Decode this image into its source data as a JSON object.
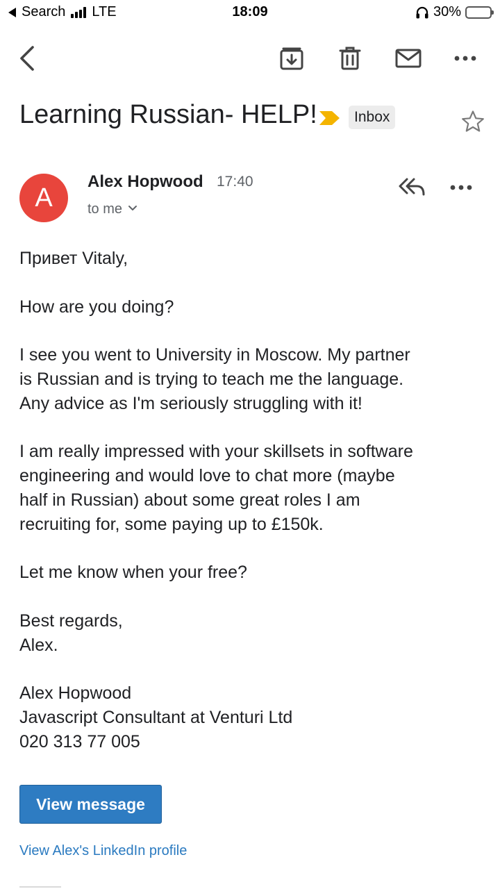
{
  "status_bar": {
    "back_app": "Search",
    "carrier": "LTE",
    "time": "18:09",
    "battery": "30%",
    "battery_level": 0.3
  },
  "toolbar": {
    "icons": [
      "back-arrow-icon",
      "archive-icon",
      "trash-icon",
      "mark-unread-icon",
      "more-icon"
    ]
  },
  "email": {
    "subject": "Learning Russian- HELP!",
    "label": "Inbox",
    "importance_color": "#f4b400",
    "sender": {
      "initial": "A",
      "avatar_color": "#e8453c",
      "name": "Alex Hopwood",
      "time": "17:40",
      "recipient": "to me"
    },
    "body": {
      "greeting": "Привет Vitaly,",
      "p1": "How are you doing?",
      "p2": [
        "I see you went to University in Moscow. My partner",
        "is Russian and is trying to teach me the language.",
        "Any advice as I'm seriously struggling with it!"
      ],
      "p3": [
        "I am really impressed with your skillsets in software",
        "engineering and would love to chat more (maybe",
        "half in Russian) about some great roles I am",
        "recruiting for, some paying up to £150k."
      ],
      "p4": "Let me know when your free?",
      "signoff": [
        "Best regards,",
        "Alex."
      ],
      "signature": [
        "Alex Hopwood",
        "Javascript Consultant at Venturi Ltd",
        "020 313 77 005"
      ]
    },
    "view_button": "View message",
    "profile_link": "View Alex's LinkedIn profile"
  }
}
